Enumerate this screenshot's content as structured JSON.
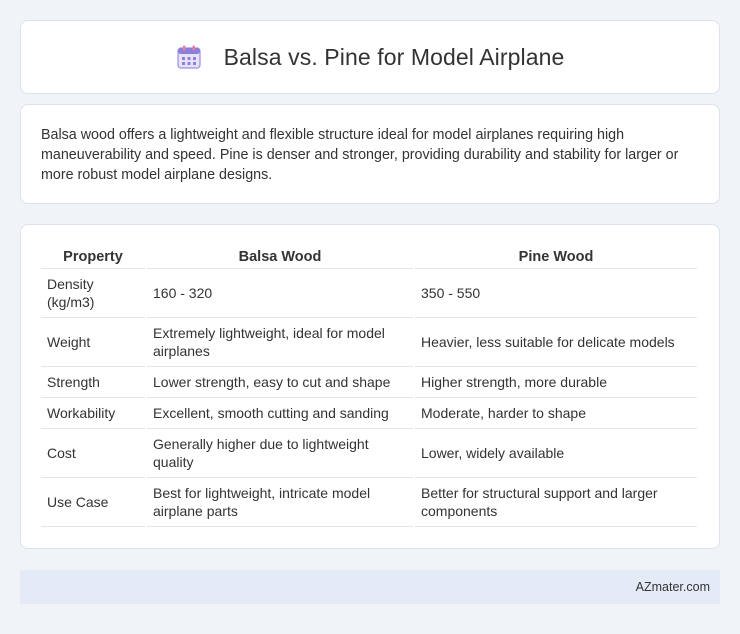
{
  "header": {
    "title": "Balsa vs. Pine for Model Airplane",
    "icon": "calendar-icon",
    "icon_color": "#8b7fd8"
  },
  "description": "Balsa wood offers a lightweight and flexible structure ideal for model airplanes requiring high maneuverability and speed. Pine is denser and stronger, providing durability and stability for larger or more robust model airplane designs.",
  "table": {
    "headers": [
      "Property",
      "Balsa Wood",
      "Pine Wood"
    ],
    "rows": [
      [
        "Density (kg/m3)",
        "160 - 320",
        "350 - 550"
      ],
      [
        "Weight",
        "Extremely lightweight, ideal for model airplanes",
        "Heavier, less suitable for delicate models"
      ],
      [
        "Strength",
        "Lower strength, easy to cut and shape",
        "Higher strength, more durable"
      ],
      [
        "Workability",
        "Excellent, smooth cutting and sanding",
        "Moderate, harder to shape"
      ],
      [
        "Cost",
        "Generally higher due to lightweight quality",
        "Lower, widely available"
      ],
      [
        "Use Case",
        "Best for lightweight, intricate model airplane parts",
        "Better for structural support and larger components"
      ]
    ]
  },
  "footer": {
    "brand": "AZmater.com"
  }
}
